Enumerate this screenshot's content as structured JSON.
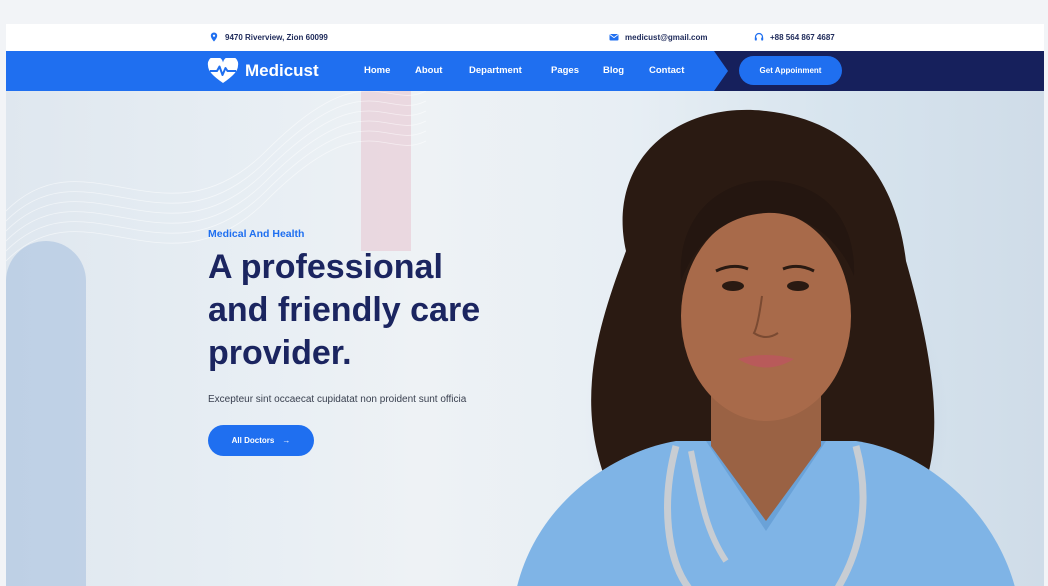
{
  "topbar": {
    "address": "9470 Riverview, Zion 60099",
    "email": "medicust@gmail.com",
    "phone": "+88 564 867 4687"
  },
  "logo": {
    "text": "Medicust"
  },
  "nav": {
    "items": [
      "Home",
      "About",
      "Department",
      "Pages",
      "Blog",
      "Contact"
    ],
    "cta": "Get Appoinment"
  },
  "hero": {
    "eyebrow": "Medical And Health",
    "headline_lines": [
      "A professional",
      "and friendly care",
      "provider."
    ],
    "description": "Excepteur sint occaecat cupidatat non proident sunt officia",
    "button": "All Doctors",
    "button_arrow": "→"
  },
  "icons": {
    "address": "map-pin-icon",
    "email": "envelope-icon",
    "phone": "headset-icon",
    "logo": "heart-pulse-icon"
  },
  "colors": {
    "brand_blue": "#1f6ff0",
    "navy": "#16205c",
    "headline": "#1b2560"
  }
}
